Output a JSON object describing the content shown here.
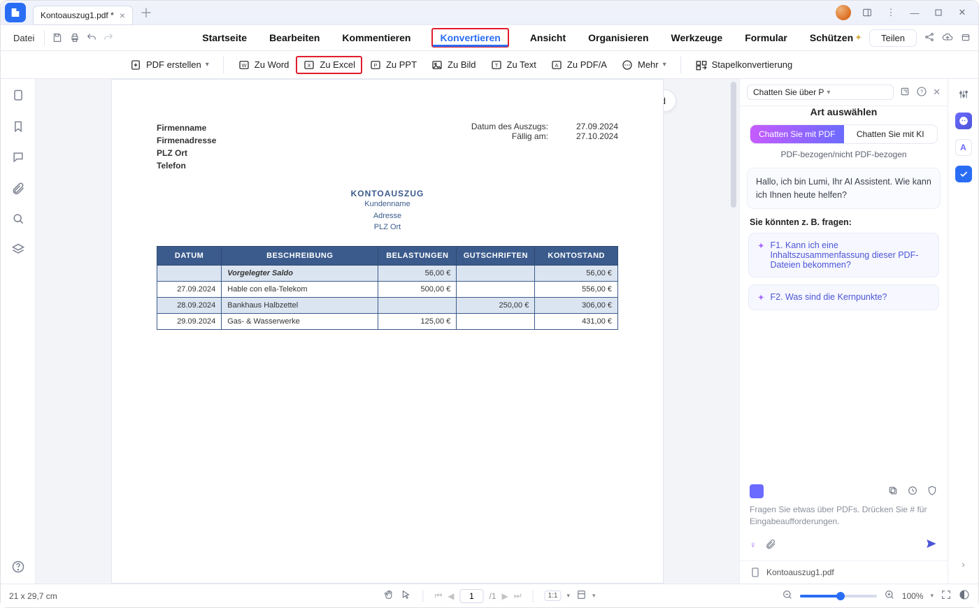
{
  "tab": {
    "name": "Kontoauszug1.pdf *"
  },
  "file_menu_label": "Datei",
  "menu": {
    "items": [
      "Startseite",
      "Bearbeiten",
      "Kommentieren",
      "Konvertieren",
      "Ansicht",
      "Organisieren",
      "Werkzeuge",
      "Formular",
      "Schützen"
    ],
    "active_index": 3,
    "share_label": "Teilen"
  },
  "toolbar": {
    "create_pdf": "PDF erstellen",
    "to_word": "Zu Word",
    "to_excel": "Zu Excel",
    "to_ppt": "Zu PPT",
    "to_img": "Zu Bild",
    "to_text": "Zu Text",
    "to_pdfa": "Zu PDF/A",
    "more": "Mehr",
    "batch": "Stapelkonvertierung"
  },
  "float_badge": "PDF zu Word",
  "doc": {
    "left_lines": [
      "Firmenname",
      "Firmenadresse",
      "PLZ Ort",
      "Telefon"
    ],
    "right_rows": [
      {
        "label": "Datum des Auszugs:",
        "value": "27.09.2024"
      },
      {
        "label": "Fällig am:",
        "value": "27.10.2024"
      }
    ],
    "title": "KONTOAUSZUG",
    "sub_lines": [
      "Kundenname",
      "Adresse",
      "PLZ Ort"
    ],
    "columns": [
      "DATUM",
      "BESCHREIBUNG",
      "BELASTUNGEN",
      "GUTSCHRIFTEN",
      "KONTOSTAND"
    ],
    "rows": [
      {
        "alt": true,
        "datum": "",
        "beschr": "Vorgelegter Saldo",
        "bel": "56,00 €",
        "gut": "",
        "stand": "56,00 €"
      },
      {
        "alt": false,
        "datum": "27.09.2024",
        "beschr": "Hable con ella-Telekom",
        "bel": "500,00 €",
        "gut": "",
        "stand": "556,00 €"
      },
      {
        "alt": true,
        "datum": "28.09.2024",
        "beschr": "Bankhaus Halbzettel",
        "bel": "",
        "gut": "250,00 €",
        "stand": "306,00 €"
      },
      {
        "alt": false,
        "datum": "29.09.2024",
        "beschr": "Gas- & Wasserwerke",
        "bel": "125,00 €",
        "gut": "",
        "stand": "431,00 €"
      }
    ]
  },
  "ai": {
    "dropdown": "Chatten Sie über P",
    "section_title": "Art auswählen",
    "seg_on": "Chatten Sie mit PDF",
    "seg_off": "Chatten Sie mit KI",
    "subline": "PDF-bezogen/nicht PDF-bezogen",
    "greeting": "Hallo, ich bin Lumi, Ihr AI Assistent. Wie kann ich Ihnen heute helfen?",
    "suggestions_header": "Sie könnten z. B. fragen:",
    "sugg1": "F1. Kann ich eine Inhaltszusammenfassung dieser PDF-Dateien bekommen?",
    "sugg2": "F2. Was sind die Kernpunkte?",
    "hint": "Fragen Sie etwas über PDFs. Drücken Sie # für Eingabeaufforderungen.",
    "file": "Kontoauszug1.pdf"
  },
  "status": {
    "page_size": "21 x 29,7 cm",
    "page_current": "1",
    "page_total": "/1",
    "fit_label": "1:1",
    "zoom_pct": "100%"
  }
}
